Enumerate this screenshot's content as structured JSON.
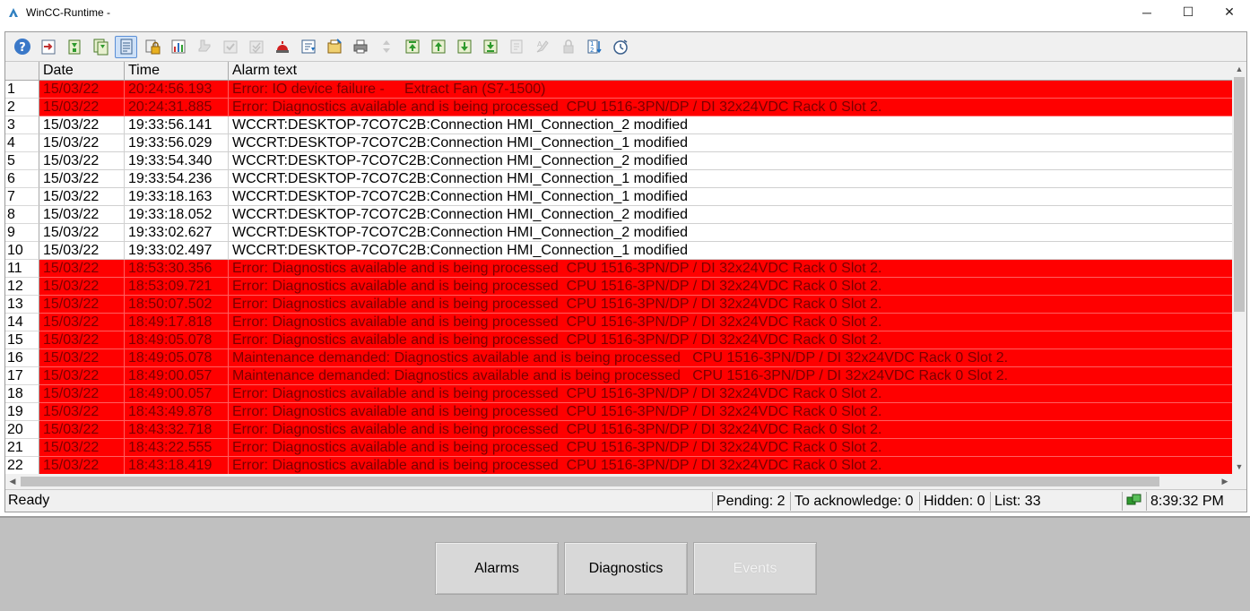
{
  "window": {
    "title": "WinCC-Runtime -",
    "minimize_glyph": "─",
    "maximize_glyph": "☐",
    "close_glyph": "✕"
  },
  "toolbar": {
    "icons": [
      "help-icon",
      "loop-in-alarm-icon",
      "archive-list-icon",
      "historical-list-icon",
      "single-alarm-list-icon",
      "lock-list-icon",
      "statistics-icon",
      "single-acknowledge-icon",
      "group-acknowledge-icon",
      "emergency-acknowledge-icon",
      "horn-icon",
      "sort-dialog-icon",
      "selection-dialog-icon",
      "print-icon",
      "scroll-icon",
      "first-alarm-icon",
      "previous-alarm-icon",
      "next-alarm-icon",
      "last-alarm-icon",
      "info-text-icon",
      "comment-icon",
      "lock-icon",
      "sort-order-icon",
      "time-base-icon"
    ],
    "active_icon": "historical-list-icon"
  },
  "table": {
    "columns": [
      "",
      "Date",
      "Time",
      "Alarm text"
    ],
    "rows": [
      {
        "n": "1",
        "date": "15/03/22",
        "time": "20:24:56.193",
        "text": "Error: IO device failure -     Extract Fan (S7-1500)",
        "status": "alarm"
      },
      {
        "n": "2",
        "date": "15/03/22",
        "time": "20:24:31.885",
        "text": "Error: Diagnostics available and is being processed  CPU 1516-3PN/DP / DI 32x24VDC Rack 0 Slot 2.",
        "status": "alarm"
      },
      {
        "n": "3",
        "date": "15/03/22",
        "time": "19:33:56.141",
        "text": "WCCRT:DESKTOP-7CO7C2B:Connection HMI_Connection_2 modified",
        "status": "info"
      },
      {
        "n": "4",
        "date": "15/03/22",
        "time": "19:33:56.029",
        "text": "WCCRT:DESKTOP-7CO7C2B:Connection HMI_Connection_1 modified",
        "status": "info"
      },
      {
        "n": "5",
        "date": "15/03/22",
        "time": "19:33:54.340",
        "text": "WCCRT:DESKTOP-7CO7C2B:Connection HMI_Connection_2 modified",
        "status": "info"
      },
      {
        "n": "6",
        "date": "15/03/22",
        "time": "19:33:54.236",
        "text": "WCCRT:DESKTOP-7CO7C2B:Connection HMI_Connection_1 modified",
        "status": "info"
      },
      {
        "n": "7",
        "date": "15/03/22",
        "time": "19:33:18.163",
        "text": "WCCRT:DESKTOP-7CO7C2B:Connection HMI_Connection_1 modified",
        "status": "info"
      },
      {
        "n": "8",
        "date": "15/03/22",
        "time": "19:33:18.052",
        "text": "WCCRT:DESKTOP-7CO7C2B:Connection HMI_Connection_2 modified",
        "status": "info"
      },
      {
        "n": "9",
        "date": "15/03/22",
        "time": "19:33:02.627",
        "text": "WCCRT:DESKTOP-7CO7C2B:Connection HMI_Connection_2 modified",
        "status": "info"
      },
      {
        "n": "10",
        "date": "15/03/22",
        "time": "19:33:02.497",
        "text": "WCCRT:DESKTOP-7CO7C2B:Connection HMI_Connection_1 modified",
        "status": "info"
      },
      {
        "n": "11",
        "date": "15/03/22",
        "time": "18:53:30.356",
        "text": "Error: Diagnostics available and is being processed  CPU 1516-3PN/DP / DI 32x24VDC Rack 0 Slot 2.",
        "status": "alarm"
      },
      {
        "n": "12",
        "date": "15/03/22",
        "time": "18:53:09.721",
        "text": "Error: Diagnostics available and is being processed  CPU 1516-3PN/DP / DI 32x24VDC Rack 0 Slot 2.",
        "status": "alarm"
      },
      {
        "n": "13",
        "date": "15/03/22",
        "time": "18:50:07.502",
        "text": "Error: Diagnostics available and is being processed  CPU 1516-3PN/DP / DI 32x24VDC Rack 0 Slot 2.",
        "status": "alarm"
      },
      {
        "n": "14",
        "date": "15/03/22",
        "time": "18:49:17.818",
        "text": "Error: Diagnostics available and is being processed  CPU 1516-3PN/DP / DI 32x24VDC Rack 0 Slot 2.",
        "status": "alarm"
      },
      {
        "n": "15",
        "date": "15/03/22",
        "time": "18:49:05.078",
        "text": "Error: Diagnostics available and is being processed  CPU 1516-3PN/DP / DI 32x24VDC Rack 0 Slot 2.",
        "status": "alarm"
      },
      {
        "n": "16",
        "date": "15/03/22",
        "time": "18:49:05.078",
        "text": "Maintenance demanded: Diagnostics available and is being processed   CPU 1516-3PN/DP / DI 32x24VDC Rack 0 Slot 2.",
        "status": "alarm"
      },
      {
        "n": "17",
        "date": "15/03/22",
        "time": "18:49:00.057",
        "text": "Maintenance demanded: Diagnostics available and is being processed   CPU 1516-3PN/DP / DI 32x24VDC Rack 0 Slot 2.",
        "status": "alarm"
      },
      {
        "n": "18",
        "date": "15/03/22",
        "time": "18:49:00.057",
        "text": "Error: Diagnostics available and is being processed  CPU 1516-3PN/DP / DI 32x24VDC Rack 0 Slot 2.",
        "status": "alarm"
      },
      {
        "n": "19",
        "date": "15/03/22",
        "time": "18:43:49.878",
        "text": "Error: Diagnostics available and is being processed  CPU 1516-3PN/DP / DI 32x24VDC Rack 0 Slot 2.",
        "status": "alarm"
      },
      {
        "n": "20",
        "date": "15/03/22",
        "time": "18:43:32.718",
        "text": "Error: Diagnostics available and is being processed  CPU 1516-3PN/DP / DI 32x24VDC Rack 0 Slot 2.",
        "status": "alarm"
      },
      {
        "n": "21",
        "date": "15/03/22",
        "time": "18:43:22.555",
        "text": "Error: Diagnostics available and is being processed  CPU 1516-3PN/DP / DI 32x24VDC Rack 0 Slot 2.",
        "status": "alarm"
      },
      {
        "n": "22",
        "date": "15/03/22",
        "time": "18:43:18.419",
        "text": "Error: Diagnostics available and is being processed  CPU 1516-3PN/DP / DI 32x24VDC Rack 0 Slot 2.",
        "status": "alarm"
      }
    ]
  },
  "statusbar": {
    "ready": "Ready",
    "pending": "Pending: 2",
    "to_acknowledge": "To acknowledge: 0",
    "hidden": "Hidden: 0",
    "list": "List: 33",
    "connection_icon": "connection-status-icon",
    "time": "8:39:32 PM"
  },
  "nav_buttons": {
    "alarms": "Alarms",
    "diagnostics": "Diagnostics",
    "events": "Events"
  },
  "colors": {
    "alarm_background": "#ff0000",
    "alarm_text": "#7a0000",
    "info_background": "#ffffff",
    "panel_background": "#c0c0c0"
  }
}
